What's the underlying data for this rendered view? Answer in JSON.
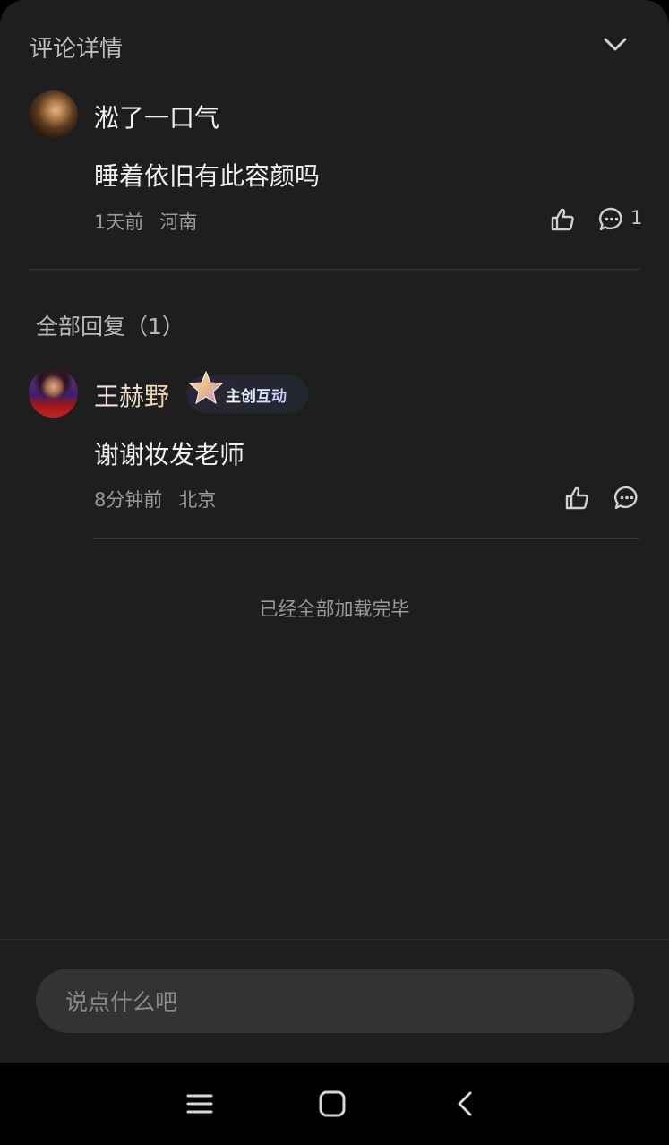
{
  "header": {
    "title": "评论详情"
  },
  "comment": {
    "username": "淞了一口气",
    "content": "睡着依旧有此容颜吗",
    "time": "1天前",
    "location": "河南",
    "reply_count": "1"
  },
  "replies_section": {
    "title": "全部回复（1）"
  },
  "reply": {
    "username": "王赫野",
    "badge": "主创互动",
    "content": "谢谢妆发老师",
    "time": "8分钟前",
    "location": "北京"
  },
  "end_message": "已经全部加载完毕",
  "input": {
    "placeholder": "说点什么吧"
  },
  "colors": {
    "background": "#1e1e1e",
    "input_bg": "#333333",
    "text_primary": "#f0f0f0",
    "text_secondary": "#9a9a9a"
  }
}
